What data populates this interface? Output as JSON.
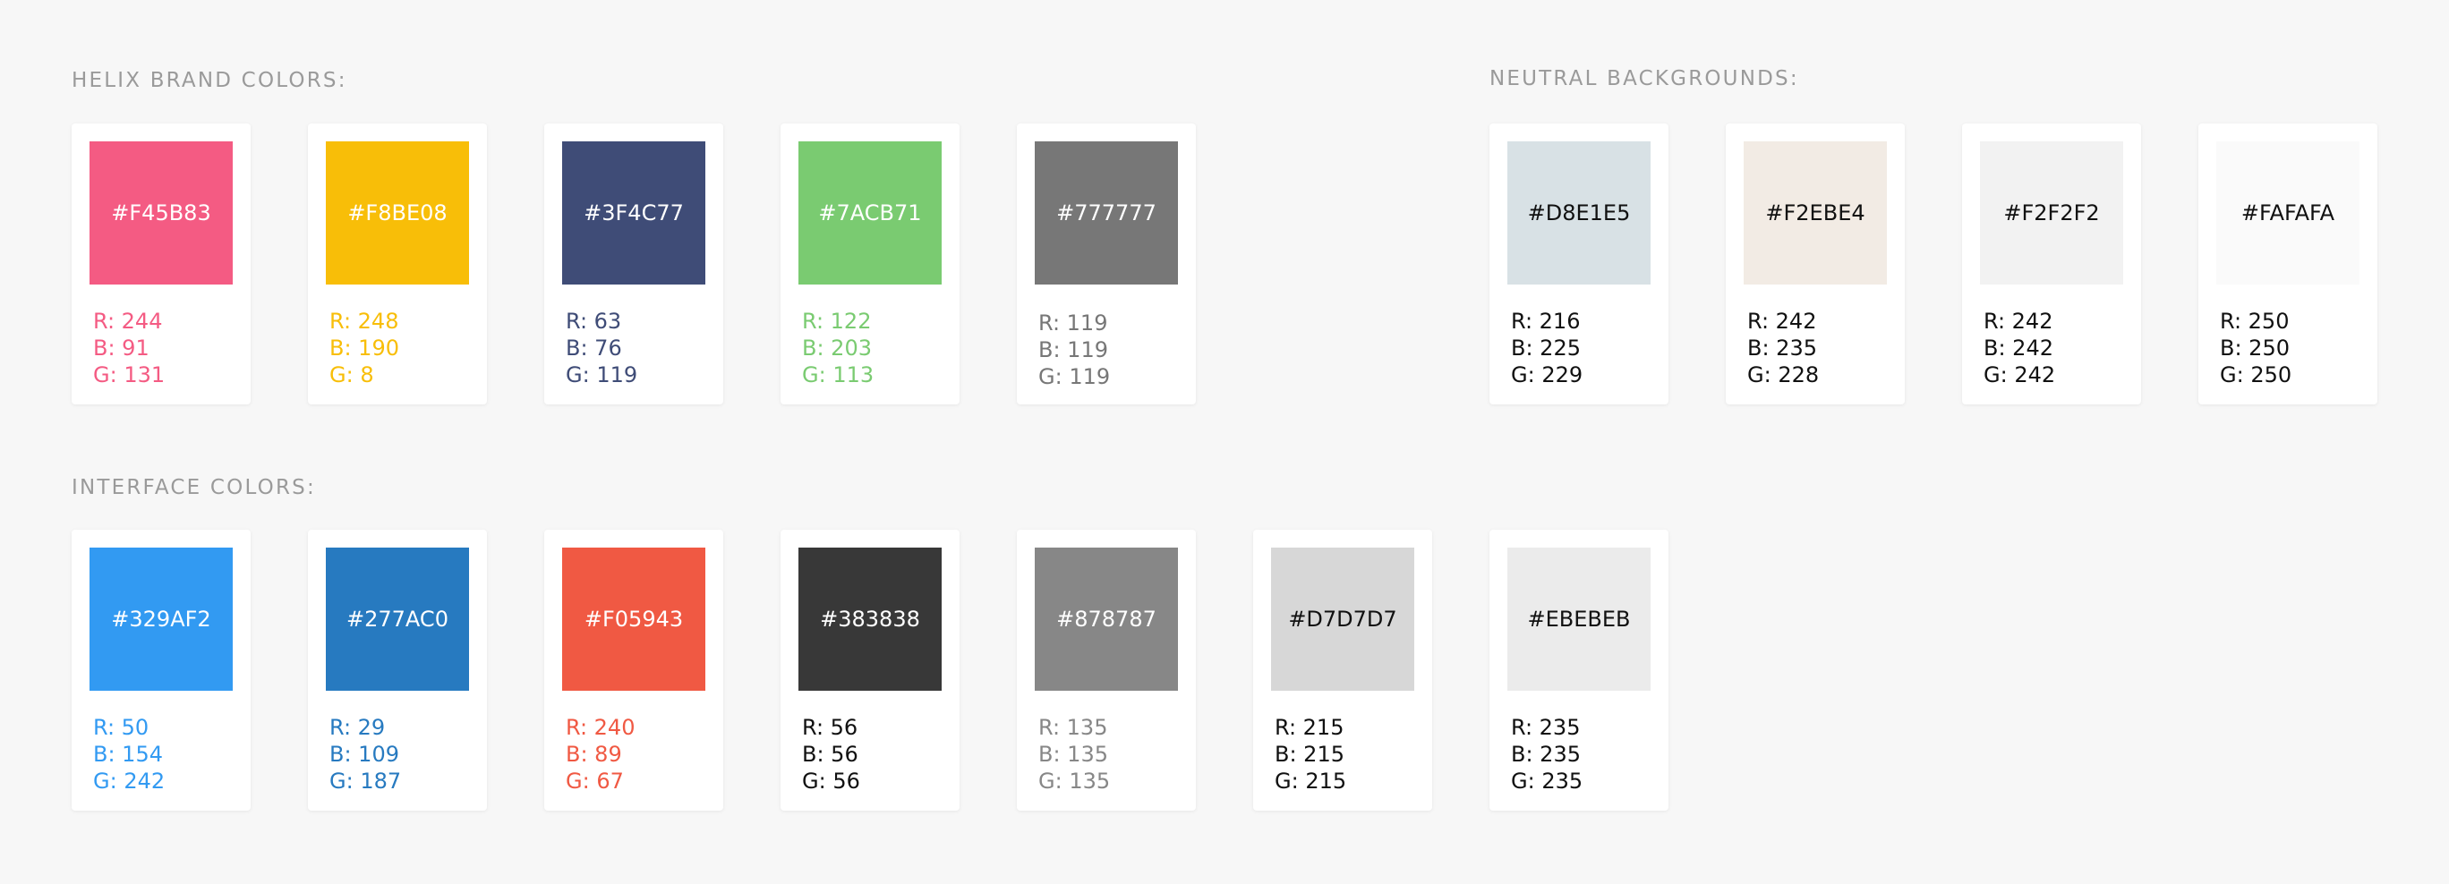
{
  "sections": {
    "brand": {
      "title": "HELIX BRAND COLORS:"
    },
    "neutral": {
      "title": "NEUTRAL BACKGROUNDS:"
    },
    "interface": {
      "title": "INTERFACE COLORS:"
    }
  },
  "swatches": [
    {
      "group": "brand",
      "hex": "#F45B83",
      "r": "R: 244",
      "b": "B: 91",
      "g": "G: 131",
      "color": "#F45B83",
      "hex_text_color": "#FFFFFF",
      "rgb_text_color": "#F45B83"
    },
    {
      "group": "brand",
      "hex": "#F8BE08",
      "r": "R: 248",
      "b": "B: 190",
      "g": "G: 8",
      "color": "#F8BE08",
      "hex_text_color": "#FFFFFF",
      "rgb_text_color": "#F8BE08"
    },
    {
      "group": "brand",
      "hex": "#3F4C77",
      "r": "R: 63",
      "b": "B: 76",
      "g": "G: 119",
      "color": "#3F4C77",
      "hex_text_color": "#FFFFFF",
      "rgb_text_color": "#3F4C77"
    },
    {
      "group": "brand",
      "hex": "#7ACB71",
      "r": "R: 122",
      "b": "B: 203",
      "g": "G: 113",
      "color": "#7ACB71",
      "hex_text_color": "#FFFFFF",
      "rgb_text_color": "#7ACB71"
    },
    {
      "group": "brand",
      "hex": "#777777",
      "r": "R: 119",
      "b": "B: 119",
      "g": "G: 119",
      "color": "#777777",
      "hex_text_color": "#FFFFFF",
      "rgb_text_color": "#777777"
    },
    {
      "group": "neutral",
      "hex": "#D8E1E5",
      "r": "R: 216",
      "b": "B: 225",
      "g": "G: 229",
      "color": "#D8E1E5",
      "hex_text_color": "#111111",
      "rgb_text_color": "#111111"
    },
    {
      "group": "neutral",
      "hex": "#F2EBE4",
      "r": "R: 242",
      "b": "B: 235",
      "g": "G: 228",
      "color": "#F2EBE4",
      "hex_text_color": "#111111",
      "rgb_text_color": "#111111"
    },
    {
      "group": "neutral",
      "hex": "#F2F2F2",
      "r": "R: 242",
      "b": "B: 242",
      "g": "G: 242",
      "color": "#F2F2F2",
      "hex_text_color": "#111111",
      "rgb_text_color": "#111111"
    },
    {
      "group": "neutral",
      "hex": "#FAFAFA",
      "r": "R: 250",
      "b": "B: 250",
      "g": "G: 250",
      "color": "#FAFAFA",
      "hex_text_color": "#111111",
      "rgb_text_color": "#111111"
    },
    {
      "group": "interface",
      "hex": "#329AF2",
      "r": "R: 50",
      "b": "B: 154",
      "g": "G: 242",
      "color": "#329AF2",
      "hex_text_color": "#FFFFFF",
      "rgb_text_color": "#329AF2"
    },
    {
      "group": "interface",
      "hex": "#277AC0",
      "r": "R: 29",
      "b": "B: 109",
      "g": "G: 187",
      "color": "#277AC0",
      "hex_text_color": "#FFFFFF",
      "rgb_text_color": "#277AC0"
    },
    {
      "group": "interface",
      "hex": "#F05943",
      "r": "R: 240",
      "b": "B: 89",
      "g": "G: 67",
      "color": "#F05943",
      "hex_text_color": "#FFFFFF",
      "rgb_text_color": "#F05943"
    },
    {
      "group": "interface",
      "hex": "#383838",
      "r": "R: 56",
      "b": "B: 56",
      "g": "G: 56",
      "color": "#383838",
      "hex_text_color": "#FFFFFF",
      "rgb_text_color": "#111111"
    },
    {
      "group": "interface",
      "hex": "#878787",
      "r": "R: 135",
      "b": "B: 135",
      "g": "G: 135",
      "color": "#878787",
      "hex_text_color": "#FFFFFF",
      "rgb_text_color": "#878787"
    },
    {
      "group": "interface",
      "hex": "#D7D7D7",
      "r": "R: 215",
      "b": "B: 215",
      "g": "G: 215",
      "color": "#D7D7D7",
      "hex_text_color": "#111111",
      "rgb_text_color": "#111111"
    },
    {
      "group": "interface",
      "hex": "#EBEBEB",
      "r": "R: 235",
      "b": "B: 235",
      "g": "G: 235",
      "color": "#EBEBEB",
      "hex_text_color": "#111111",
      "rgb_text_color": "#111111"
    }
  ]
}
